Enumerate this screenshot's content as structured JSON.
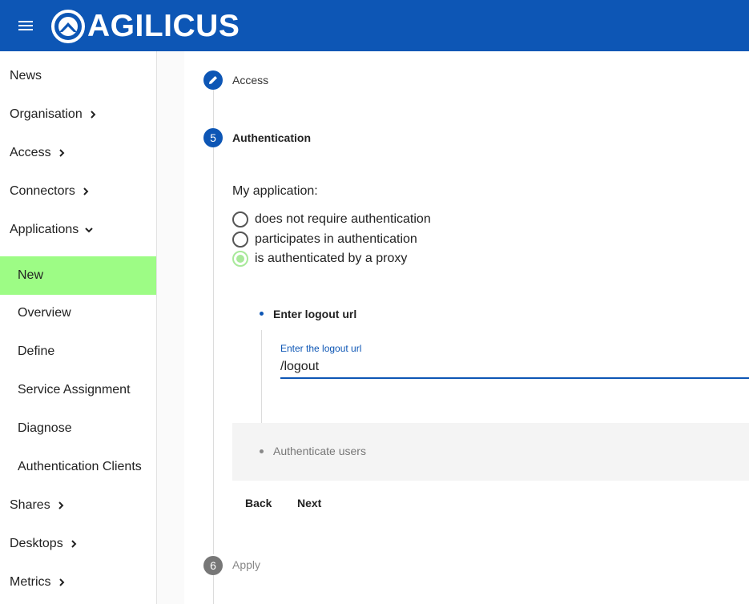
{
  "header": {
    "brand": "AGILICUS",
    "menu_icon": "hamburger-menu-icon",
    "color": "#0d56b5"
  },
  "sidebar": {
    "items": [
      {
        "label": "News",
        "expandable": false
      },
      {
        "label": "Organisation",
        "expandable": true,
        "expanded": false
      },
      {
        "label": "Access",
        "expandable": true,
        "expanded": false
      },
      {
        "label": "Connectors",
        "expandable": true,
        "expanded": false
      },
      {
        "label": "Applications",
        "expandable": true,
        "expanded": true
      },
      {
        "label": "New",
        "sub": true,
        "active": true
      },
      {
        "label": "Overview",
        "sub": true
      },
      {
        "label": "Define",
        "sub": true
      },
      {
        "label": "Service Assignment",
        "sub": true
      },
      {
        "label": "Diagnose",
        "sub": true
      },
      {
        "label": "Authentication Clients",
        "sub": true
      },
      {
        "label": "Shares",
        "expandable": true,
        "expanded": false
      },
      {
        "label": "Desktops",
        "expandable": true,
        "expanded": false
      },
      {
        "label": "Metrics",
        "expandable": true,
        "expanded": false
      }
    ],
    "active_color": "#9dfc85"
  },
  "stepper": {
    "step_access": {
      "label": "Access",
      "icon": "pencil-edit-icon"
    },
    "step_auth": {
      "number": "5",
      "label": "Authentication"
    },
    "step_apply": {
      "number": "6",
      "label": "Apply"
    },
    "question": "My application:",
    "options": [
      {
        "label": "does not require authentication",
        "checked": false
      },
      {
        "label": "participates in authentication",
        "checked": false
      },
      {
        "label": "is authenticated by a proxy",
        "checked": true
      }
    ],
    "substep_logout": {
      "title": "Enter logout url",
      "field_label": "Enter the logout url",
      "field_value": "/logout"
    },
    "substep_users": {
      "title": "Authenticate users"
    },
    "buttons": {
      "back": "Back",
      "next": "Next"
    }
  }
}
